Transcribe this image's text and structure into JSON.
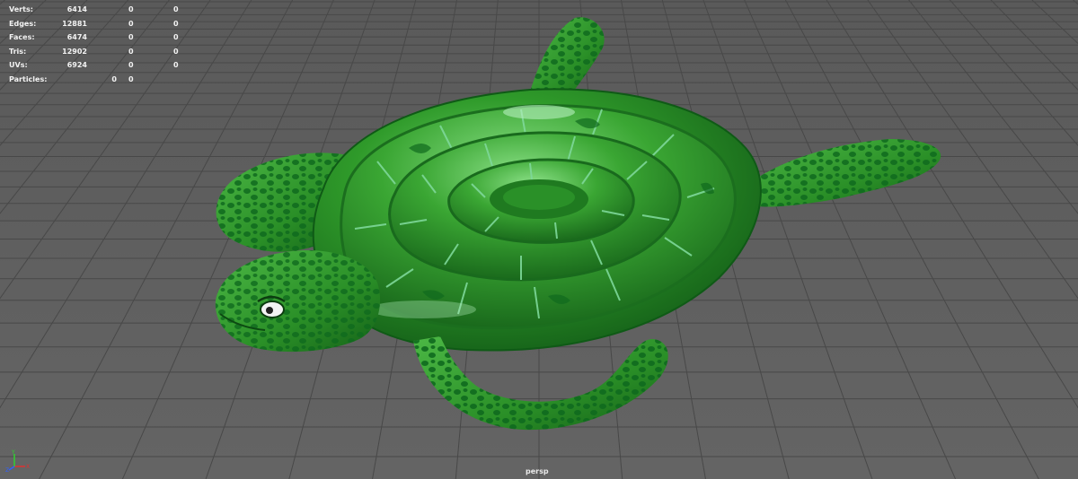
{
  "hud": {
    "rows": [
      {
        "label": "Verts:",
        "v1": "6414",
        "v2": "0",
        "v3": "0"
      },
      {
        "label": "Edges:",
        "v1": "12881",
        "v2": "0",
        "v3": "0"
      },
      {
        "label": "Faces:",
        "v1": "6474",
        "v2": "0",
        "v3": "0"
      },
      {
        "label": "Tris:",
        "v1": "12902",
        "v2": "0",
        "v3": "0"
      },
      {
        "label": "UVs:",
        "v1": "6924",
        "v2": "0",
        "v3": "0"
      }
    ],
    "particles": {
      "label": "Particles:",
      "v1": "0",
      "v2": "0"
    }
  },
  "viewport": {
    "camera": "persp",
    "axis_icon": "axis-gizmo-icon"
  },
  "colors": {
    "background": "#5d5d5d",
    "grid": "#4a4a4a",
    "body_green": "#2f9a2a",
    "dark_green": "#0f6a1e",
    "highlight": "#a8e6b0",
    "axis_x": "#e03030",
    "axis_y": "#30d030",
    "axis_z": "#3060ff"
  }
}
